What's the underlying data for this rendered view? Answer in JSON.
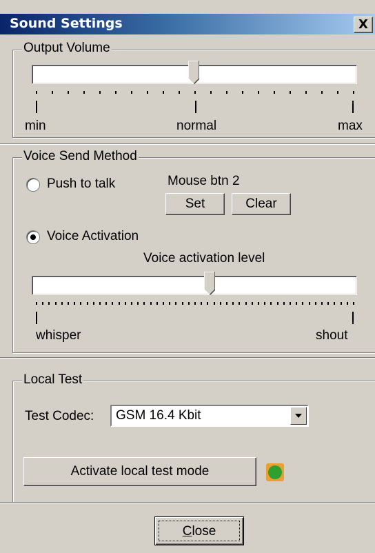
{
  "window": {
    "title": "Sound Settings",
    "close_glyph": "X"
  },
  "output_volume": {
    "legend": "Output Volume",
    "level_fraction": 0.5,
    "labels": {
      "min": "min",
      "mid": "normal",
      "max": "max"
    }
  },
  "voice_send": {
    "legend": "Voice Send Method",
    "push_to_talk_label": "Push to talk",
    "hotkey_text": "Mouse btn 2",
    "set_label": "Set",
    "clear_label": "Clear",
    "voice_activation_label": "Voice Activation",
    "selected": "voice_activation",
    "activation_title": "Voice activation level",
    "activation_fraction": 0.55,
    "labels": {
      "min": "whisper",
      "max": "shout"
    }
  },
  "local_test": {
    "legend": "Local Test",
    "codec_label": "Test Codec:",
    "codec_value": "GSM 16.4 Kbit",
    "activate_label": "Activate local test mode",
    "indicator_color": "#2fa02f"
  },
  "footer": {
    "close_label": "Close",
    "close_accesskey": "C"
  },
  "icons": {
    "dropdown": "chevron-down-icon",
    "close": "close-icon"
  }
}
